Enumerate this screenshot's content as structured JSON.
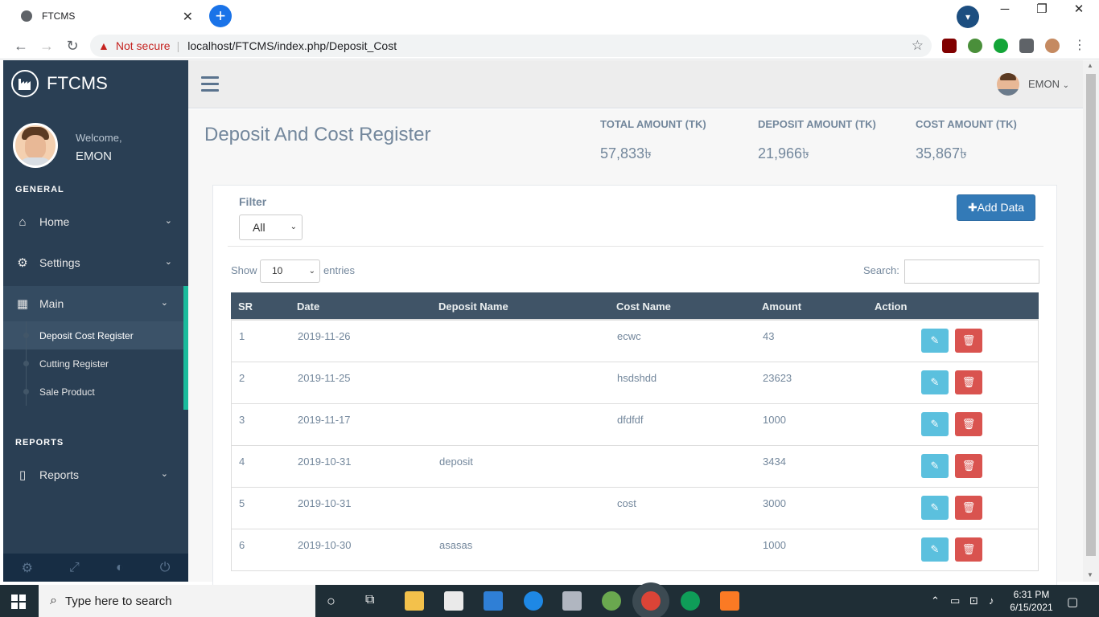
{
  "browser": {
    "tab_title": "FTCMS",
    "security": "Not secure",
    "url": "localhost/FTCMS/index.php/Deposit_Cost"
  },
  "sidebar": {
    "brand": "FTCMS",
    "welcome": "Welcome,",
    "user": "EMON",
    "section_general": "GENERAL",
    "items": [
      {
        "label": "Home",
        "icon": "home-icon"
      },
      {
        "label": "Settings",
        "icon": "gear-icon"
      },
      {
        "label": "Main",
        "icon": "table-icon"
      }
    ],
    "submenu": [
      {
        "label": "Deposit Cost Register",
        "active": true
      },
      {
        "label": "Cutting Register",
        "active": false
      },
      {
        "label": "Sale Product",
        "active": false
      }
    ],
    "section_reports": "REPORTS",
    "reports_label": "Reports",
    "accent_color": "#1abb9c"
  },
  "topnav": {
    "user": "EMON"
  },
  "page": {
    "title": "Deposit And Cost Register",
    "stats": [
      {
        "label": "TOTAL AMOUNT (TK)",
        "value": "57,833৳"
      },
      {
        "label": "DEPOSIT AMOUNT (TK)",
        "value": "21,966৳"
      },
      {
        "label": "COST AMOUNT (TK)",
        "value": "35,867৳"
      }
    ]
  },
  "panel": {
    "filter_label": "Filter",
    "filter_value": "All",
    "add_button": "Add Data",
    "show_label": "Show",
    "entries_value": "10",
    "entries_label": "entries",
    "search_label": "Search:"
  },
  "table": {
    "headers": [
      "SR",
      "Date",
      "Deposit Name",
      "Cost Name",
      "Amount",
      "Action"
    ],
    "rows": [
      {
        "sr": "1",
        "date": "2019-11-26",
        "deposit": "",
        "cost": "ecwc",
        "amount": "43"
      },
      {
        "sr": "2",
        "date": "2019-11-25",
        "deposit": "",
        "cost": "hsdshdd",
        "amount": "23623"
      },
      {
        "sr": "3",
        "date": "2019-11-17",
        "deposit": "",
        "cost": "dfdfdf",
        "amount": "1000"
      },
      {
        "sr": "4",
        "date": "2019-10-31",
        "deposit": "deposit",
        "cost": "",
        "amount": "3434"
      },
      {
        "sr": "5",
        "date": "2019-10-31",
        "deposit": "",
        "cost": "cost",
        "amount": "3000"
      },
      {
        "sr": "6",
        "date": "2019-10-30",
        "deposit": "asasas",
        "cost": "",
        "amount": "1000"
      }
    ]
  },
  "taskbar": {
    "search_placeholder": "Type here to search",
    "time": "6:31 PM",
    "date": "6/15/2021"
  }
}
